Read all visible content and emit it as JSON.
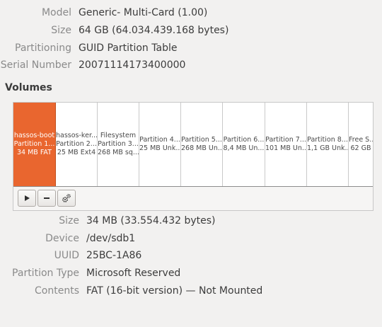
{
  "drive": {
    "rows": [
      {
        "label": "Model",
        "value": "Generic- Multi-Card (1.00)"
      },
      {
        "label": "Size",
        "value": "64 GB (64.034.439.168 bytes)"
      },
      {
        "label": "Partitioning",
        "value": "GUID Partition Table"
      },
      {
        "label": "Serial Number",
        "value": "20071114173400000"
      }
    ]
  },
  "volumes": {
    "title": "Volumes",
    "partitions": [
      {
        "line1": "hassos-boot",
        "line2": "Partition 1...",
        "line3": "34 MB FAT",
        "selected": true
      },
      {
        "line1": "hassos-ker...",
        "line2": "Partition 2...",
        "line3": "25 MB Ext4",
        "selected": false
      },
      {
        "line1": "Filesystem",
        "line2": "Partition 3...",
        "line3": "268 MB sq...",
        "selected": false
      },
      {
        "line1": "Partition 4...",
        "line2": "25 MB Unk...",
        "selected": false
      },
      {
        "line1": "Partition 5...",
        "line2": "268 MB Un...",
        "selected": false
      },
      {
        "line1": "Partition 6...",
        "line2": "8,4 MB Un...",
        "selected": false
      },
      {
        "line1": "Partition 7...",
        "line2": "101 MB Un...",
        "selected": false
      },
      {
        "line1": "Partition 8...",
        "line2": "1,1 GB Unk...",
        "selected": false
      },
      {
        "line1": "Free S...",
        "line2": "62 GB",
        "selected": false
      }
    ],
    "toolbar": [
      {
        "name": "play-icon"
      },
      {
        "name": "minus-icon"
      },
      {
        "name": "gears-icon"
      }
    ]
  },
  "details": {
    "rows": [
      {
        "label": "Size",
        "value": "34 MB (33.554.432 bytes)"
      },
      {
        "label": "Device",
        "value": "/dev/sdb1"
      },
      {
        "label": "UUID",
        "value": "25BC-1A86"
      },
      {
        "label": "Partition Type",
        "value": "Microsoft Reserved"
      },
      {
        "label": "Contents",
        "value": "FAT (16-bit version) — Not Mounted"
      }
    ]
  },
  "colors": {
    "accent": "#e9662f",
    "background": "#f2f1f0"
  }
}
